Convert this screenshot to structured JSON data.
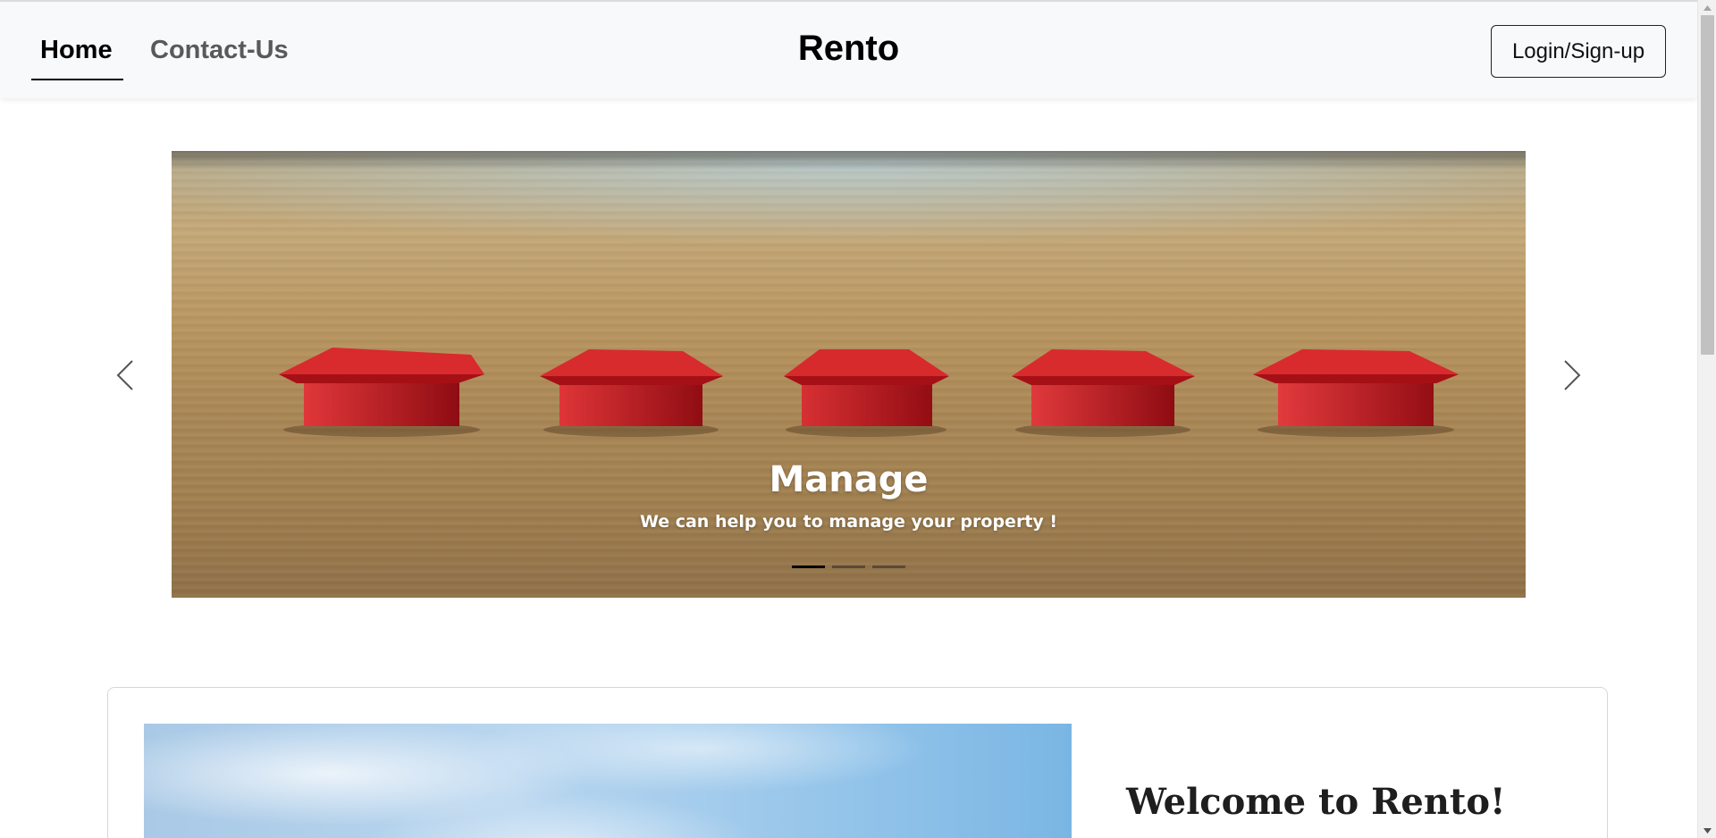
{
  "navbar": {
    "home_label": "Home",
    "contact_label": "Contact-Us",
    "brand": "Rento",
    "login_label": "Login/Sign-up"
  },
  "carousel": {
    "active_index": 0,
    "slide_count": 3,
    "caption_title": "Manage",
    "caption_text": "We can help you to manage your property !",
    "prev_icon": "chevron-left-icon",
    "next_icon": "chevron-right-icon"
  },
  "welcome": {
    "title": "Welcome to Rento!"
  },
  "colors": {
    "navbar_bg": "#f8f9fa",
    "house_red": "#c8181e",
    "indicator_active": "#000000"
  }
}
